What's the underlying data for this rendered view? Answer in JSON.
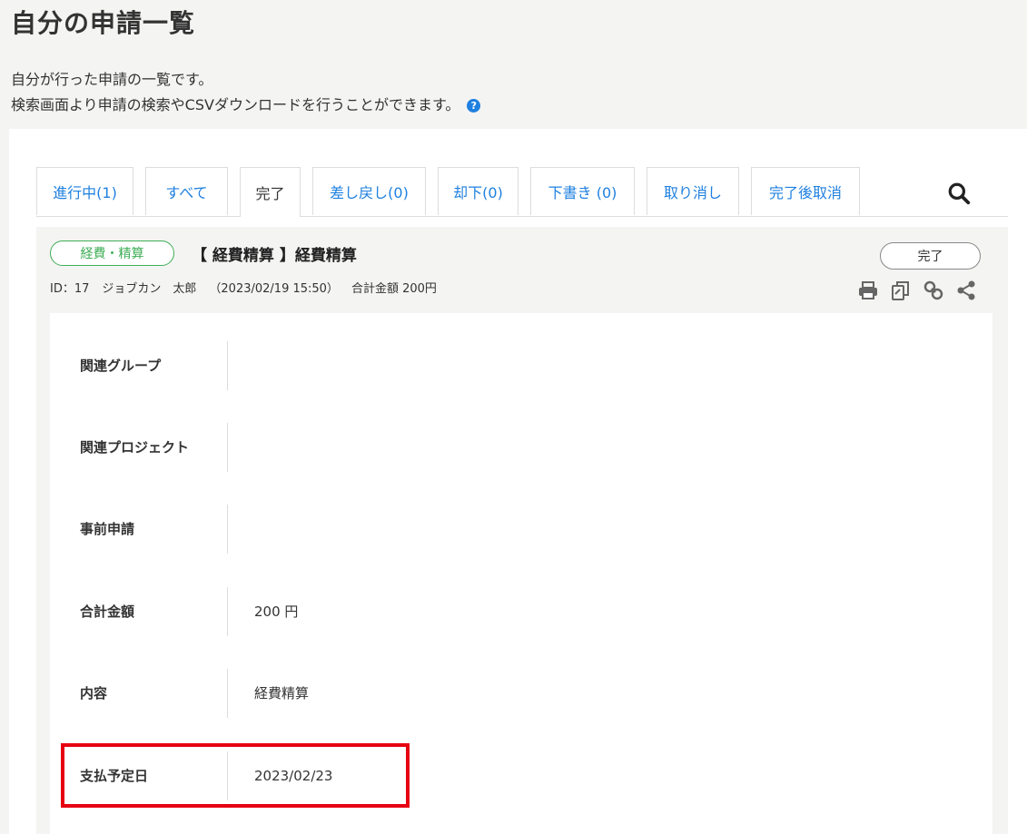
{
  "page": {
    "title": "自分の申請一覧",
    "description_line1": "自分が行った申請の一覧です。",
    "description_line2": "検索画面より申請の検索やCSVダウンロードを行うことができます。",
    "help_icon": "question-circle-icon",
    "help_icon_glyph": "?"
  },
  "tabs": [
    {
      "label": "進行中(1)"
    },
    {
      "label": "すべて"
    },
    {
      "label": "完了"
    },
    {
      "label": "差し戻し(0)"
    },
    {
      "label": "却下(0)"
    },
    {
      "label": "下書き (0)"
    },
    {
      "label": "取り消し"
    },
    {
      "label": "完了後取消"
    }
  ],
  "active_tab": "完了",
  "search_icon": "search-icon",
  "request": {
    "category": "経費・精算",
    "title": "【 経費精算 】経費精算",
    "status": "完了",
    "id": "ID：17",
    "applicant": "ジョブカン　太郎",
    "datetime": "（2023/02/19 15:50）",
    "total": "合計金額 200円",
    "action_icons": [
      "print-icon",
      "copy-icon",
      "link-icon",
      "share-icon"
    ]
  },
  "details": [
    {
      "label": "関連グループ",
      "value": ""
    },
    {
      "label": "関連プロジェクト",
      "value": ""
    },
    {
      "label": "事前申請",
      "value": ""
    },
    {
      "label": "合計金額",
      "value": "200 円"
    },
    {
      "label": "内容",
      "value": "経費精算"
    },
    {
      "label": "支払予定日",
      "value": "2023/02/23"
    }
  ],
  "colors": {
    "link": "#1f80e0",
    "badge_green": "#3fae56",
    "highlight_red": "#e60012",
    "background": "#f4f4f3"
  }
}
